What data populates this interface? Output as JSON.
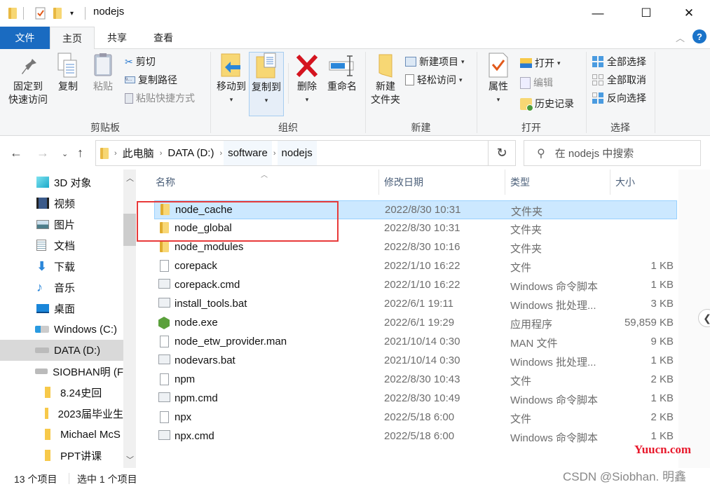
{
  "window": {
    "title": "nodejs",
    "controls": {
      "minimize": "—",
      "maximize": "☐",
      "close": "✕"
    }
  },
  "ribbon_tabs": [
    {
      "label": "文件"
    },
    {
      "label": "主页"
    },
    {
      "label": "共享"
    },
    {
      "label": "查看"
    }
  ],
  "ribbon_help": "?",
  "ribbon": {
    "clipboard": {
      "group_label": "剪贴板",
      "pin_label_1": "固定到",
      "pin_label_2": "快速访问",
      "copy": "复制",
      "paste": "粘贴",
      "cut": "剪切",
      "copy_path": "复制路径",
      "paste_shortcut": "粘贴快捷方式"
    },
    "organize": {
      "group_label": "组织",
      "move_to": "移动到",
      "copy_to": "复制到",
      "delete": "删除",
      "rename": "重命名"
    },
    "new": {
      "group_label": "新建",
      "new_folder_1": "新建",
      "new_folder_2": "文件夹",
      "new_item": "新建项目",
      "easy_access": "轻松访问"
    },
    "open": {
      "group_label": "打开",
      "properties": "属性",
      "open": "打开",
      "edit": "编辑",
      "history": "历史记录"
    },
    "select": {
      "group_label": "选择",
      "select_all": "全部选择",
      "select_none": "全部取消",
      "invert": "反向选择"
    }
  },
  "address": {
    "crumbs": [
      "此电脑",
      "DATA (D:)",
      "software",
      "nodejs"
    ],
    "search_placeholder": "在 nodejs 中搜索"
  },
  "nav_pane": {
    "items": [
      {
        "label": "3D 对象",
        "icon": "3d-objects-icon"
      },
      {
        "label": "视频",
        "icon": "video-icon"
      },
      {
        "label": "图片",
        "icon": "pictures-icon"
      },
      {
        "label": "文档",
        "icon": "documents-icon"
      },
      {
        "label": "下载",
        "icon": "download-icon"
      },
      {
        "label": "音乐",
        "icon": "music-icon"
      },
      {
        "label": "桌面",
        "icon": "desktop-icon"
      },
      {
        "label": "Windows (C:)",
        "icon": "windows-drive-icon"
      },
      {
        "label": "DATA (D:)",
        "icon": "drive-icon",
        "selected": true
      },
      {
        "label": "SIOBHAN明 (F",
        "icon": "drive-icon"
      },
      {
        "label": "8.24史回",
        "icon": "folder-icon"
      },
      {
        "label": "2023届毕业生",
        "icon": "folder-icon"
      },
      {
        "label": "Michael McS",
        "icon": "folder-icon"
      },
      {
        "label": "PPT讲课",
        "icon": "folder-icon"
      }
    ]
  },
  "columns": {
    "name": "名称",
    "date": "修改日期",
    "type": "类型",
    "size": "大小"
  },
  "files": [
    {
      "name": "node_cache",
      "date": "2022/8/30 10:31",
      "type": "文件夹",
      "size": "",
      "icon": "folder",
      "selected": true
    },
    {
      "name": "node_global",
      "date": "2022/8/30 10:31",
      "type": "文件夹",
      "size": "",
      "icon": "folder"
    },
    {
      "name": "node_modules",
      "date": "2022/8/30 10:16",
      "type": "文件夹",
      "size": "",
      "icon": "folder"
    },
    {
      "name": "corepack",
      "date": "2022/1/10 16:22",
      "type": "文件",
      "size": "1 KB",
      "icon": "file"
    },
    {
      "name": "corepack.cmd",
      "date": "2022/1/10 16:22",
      "type": "Windows 命令脚本",
      "size": "1 KB",
      "icon": "cmd"
    },
    {
      "name": "install_tools.bat",
      "date": "2022/6/1 19:11",
      "type": "Windows 批处理...",
      "size": "3 KB",
      "icon": "cmd"
    },
    {
      "name": "node.exe",
      "date": "2022/6/1 19:29",
      "type": "应用程序",
      "size": "59,859 KB",
      "icon": "exe"
    },
    {
      "name": "node_etw_provider.man",
      "date": "2021/10/14 0:30",
      "type": "MAN 文件",
      "size": "9 KB",
      "icon": "file"
    },
    {
      "name": "nodevars.bat",
      "date": "2021/10/14 0:30",
      "type": "Windows 批处理...",
      "size": "1 KB",
      "icon": "cmd"
    },
    {
      "name": "npm",
      "date": "2022/8/30 10:43",
      "type": "文件",
      "size": "2 KB",
      "icon": "file"
    },
    {
      "name": "npm.cmd",
      "date": "2022/8/30 10:49",
      "type": "Windows 命令脚本",
      "size": "1 KB",
      "icon": "cmd"
    },
    {
      "name": "npx",
      "date": "2022/5/18 6:00",
      "type": "文件",
      "size": "2 KB",
      "icon": "file"
    },
    {
      "name": "npx.cmd",
      "date": "2022/5/18 6:00",
      "type": "Windows 命令脚本",
      "size": "1 KB",
      "icon": "cmd"
    }
  ],
  "status": {
    "count": "13 个项目",
    "selected": "选中 1 个项目"
  },
  "watermarks": {
    "site": "Yuucn.com",
    "author": "CSDN @Siobhan. 明鑫"
  }
}
